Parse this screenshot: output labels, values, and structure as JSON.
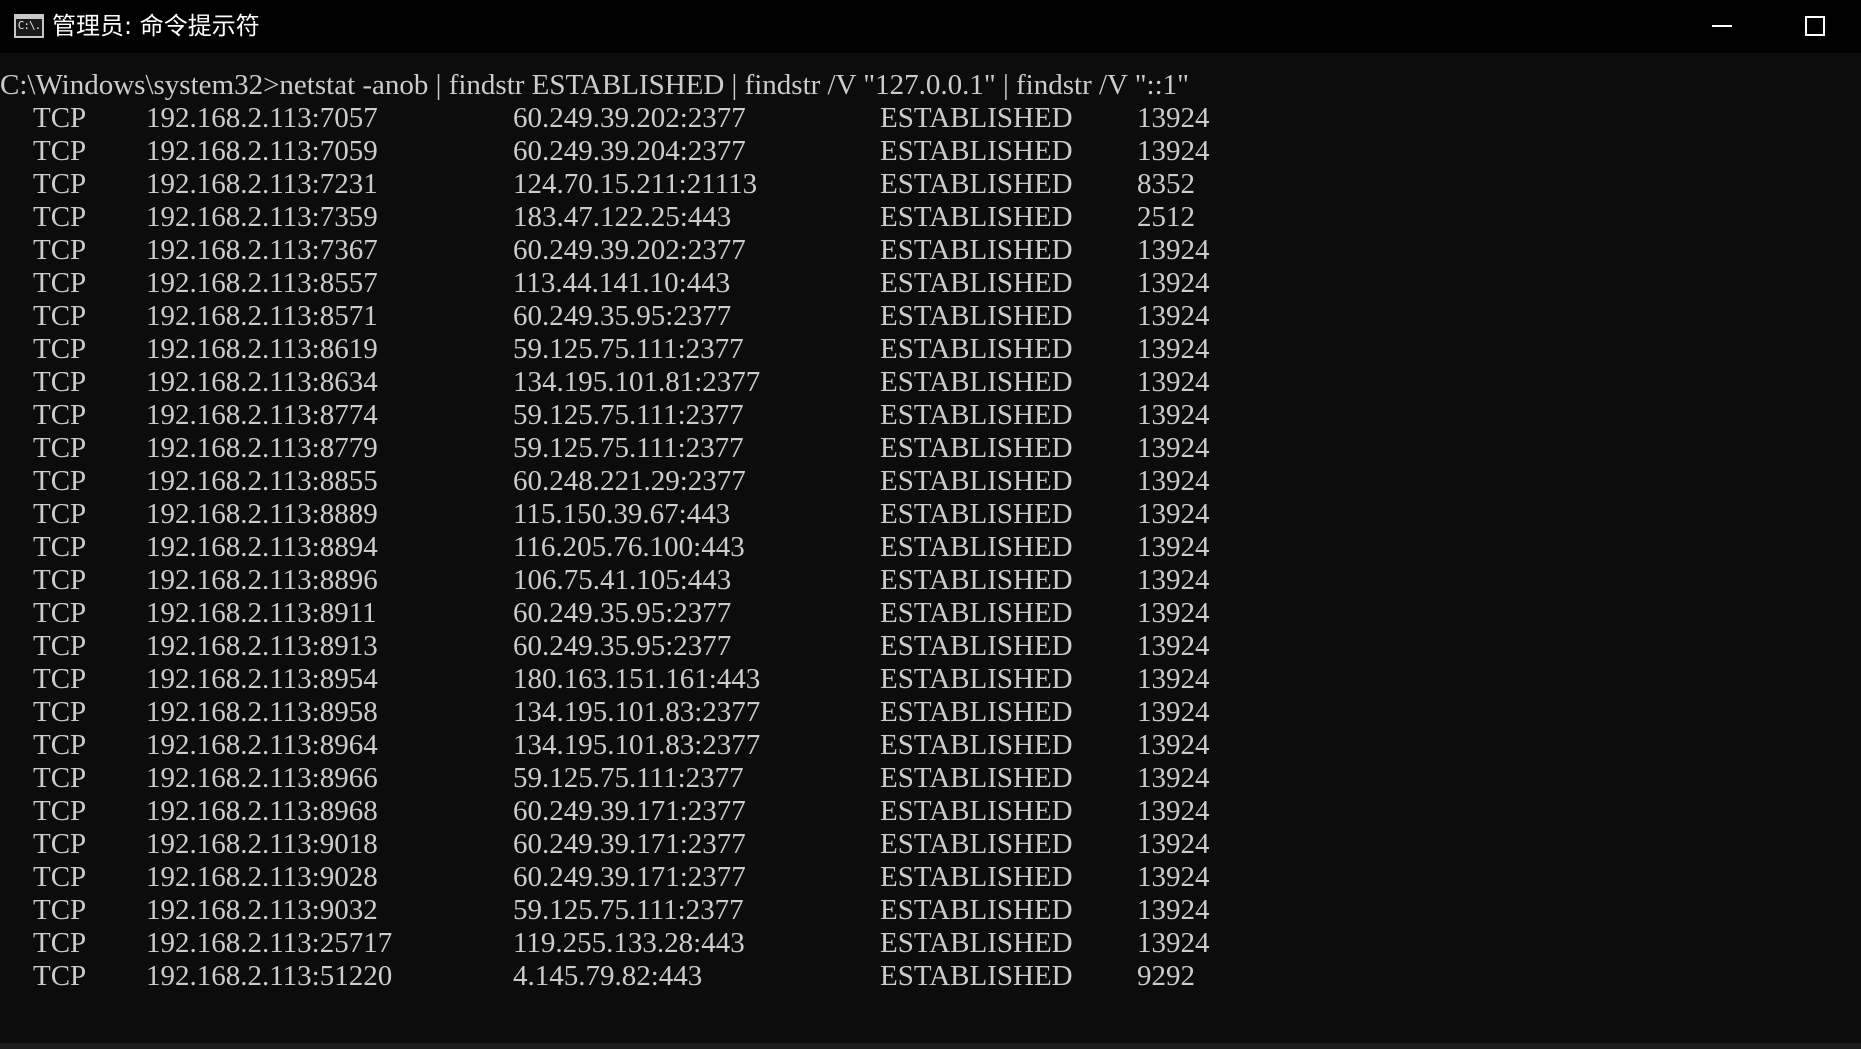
{
  "window": {
    "title": "管理员: 命令提示符",
    "icon_label": "C:\\.",
    "icon": "cmd-console-icon",
    "controls": [
      "minimize-icon",
      "maximize-icon"
    ]
  },
  "colors": {
    "background": "#0c0c0c",
    "titlebar": "#000000",
    "text": "#cccccc"
  },
  "console": {
    "command_line": "C:\\Windows\\system32>netstat -anob | findstr ESTABLISHED | findstr /V \"127.0.0.1\" | findstr /V \"::1\"",
    "rows": [
      {
        "proto": "TCP",
        "local": "192.168.2.113:7057",
        "remote": "60.249.39.202:2377",
        "state": "ESTABLISHED",
        "pid": "13924"
      },
      {
        "proto": "TCP",
        "local": "192.168.2.113:7059",
        "remote": "60.249.39.204:2377",
        "state": "ESTABLISHED",
        "pid": "13924"
      },
      {
        "proto": "TCP",
        "local": "192.168.2.113:7231",
        "remote": "124.70.15.211:21113",
        "state": "ESTABLISHED",
        "pid": "8352"
      },
      {
        "proto": "TCP",
        "local": "192.168.2.113:7359",
        "remote": "183.47.122.25:443",
        "state": "ESTABLISHED",
        "pid": "2512"
      },
      {
        "proto": "TCP",
        "local": "192.168.2.113:7367",
        "remote": "60.249.39.202:2377",
        "state": "ESTABLISHED",
        "pid": "13924"
      },
      {
        "proto": "TCP",
        "local": "192.168.2.113:8557",
        "remote": "113.44.141.10:443",
        "state": "ESTABLISHED",
        "pid": "13924"
      },
      {
        "proto": "TCP",
        "local": "192.168.2.113:8571",
        "remote": "60.249.35.95:2377",
        "state": "ESTABLISHED",
        "pid": "13924"
      },
      {
        "proto": "TCP",
        "local": "192.168.2.113:8619",
        "remote": "59.125.75.111:2377",
        "state": "ESTABLISHED",
        "pid": "13924"
      },
      {
        "proto": "TCP",
        "local": "192.168.2.113:8634",
        "remote": "134.195.101.81:2377",
        "state": "ESTABLISHED",
        "pid": "13924"
      },
      {
        "proto": "TCP",
        "local": "192.168.2.113:8774",
        "remote": "59.125.75.111:2377",
        "state": "ESTABLISHED",
        "pid": "13924"
      },
      {
        "proto": "TCP",
        "local": "192.168.2.113:8779",
        "remote": "59.125.75.111:2377",
        "state": "ESTABLISHED",
        "pid": "13924"
      },
      {
        "proto": "TCP",
        "local": "192.168.2.113:8855",
        "remote": "60.248.221.29:2377",
        "state": "ESTABLISHED",
        "pid": "13924"
      },
      {
        "proto": "TCP",
        "local": "192.168.2.113:8889",
        "remote": "115.150.39.67:443",
        "state": "ESTABLISHED",
        "pid": "13924"
      },
      {
        "proto": "TCP",
        "local": "192.168.2.113:8894",
        "remote": "116.205.76.100:443",
        "state": "ESTABLISHED",
        "pid": "13924"
      },
      {
        "proto": "TCP",
        "local": "192.168.2.113:8896",
        "remote": "106.75.41.105:443",
        "state": "ESTABLISHED",
        "pid": "13924"
      },
      {
        "proto": "TCP",
        "local": "192.168.2.113:8911",
        "remote": "60.249.35.95:2377",
        "state": "ESTABLISHED",
        "pid": "13924"
      },
      {
        "proto": "TCP",
        "local": "192.168.2.113:8913",
        "remote": "60.249.35.95:2377",
        "state": "ESTABLISHED",
        "pid": "13924"
      },
      {
        "proto": "TCP",
        "local": "192.168.2.113:8954",
        "remote": "180.163.151.161:443",
        "state": "ESTABLISHED",
        "pid": "13924"
      },
      {
        "proto": "TCP",
        "local": "192.168.2.113:8958",
        "remote": "134.195.101.83:2377",
        "state": "ESTABLISHED",
        "pid": "13924"
      },
      {
        "proto": "TCP",
        "local": "192.168.2.113:8964",
        "remote": "134.195.101.83:2377",
        "state": "ESTABLISHED",
        "pid": "13924"
      },
      {
        "proto": "TCP",
        "local": "192.168.2.113:8966",
        "remote": "59.125.75.111:2377",
        "state": "ESTABLISHED",
        "pid": "13924"
      },
      {
        "proto": "TCP",
        "local": "192.168.2.113:8968",
        "remote": "60.249.39.171:2377",
        "state": "ESTABLISHED",
        "pid": "13924"
      },
      {
        "proto": "TCP",
        "local": "192.168.2.113:9018",
        "remote": "60.249.39.171:2377",
        "state": "ESTABLISHED",
        "pid": "13924"
      },
      {
        "proto": "TCP",
        "local": "192.168.2.113:9028",
        "remote": "60.249.39.171:2377",
        "state": "ESTABLISHED",
        "pid": "13924"
      },
      {
        "proto": "TCP",
        "local": "192.168.2.113:9032",
        "remote": "59.125.75.111:2377",
        "state": "ESTABLISHED",
        "pid": "13924"
      },
      {
        "proto": "TCP",
        "local": "192.168.2.113:25717",
        "remote": "119.255.133.28:443",
        "state": "ESTABLISHED",
        "pid": "13924"
      },
      {
        "proto": "TCP",
        "local": "192.168.2.113:51220",
        "remote": "4.145.79.82:443",
        "state": "ESTABLISHED",
        "pid": "9292"
      }
    ]
  }
}
